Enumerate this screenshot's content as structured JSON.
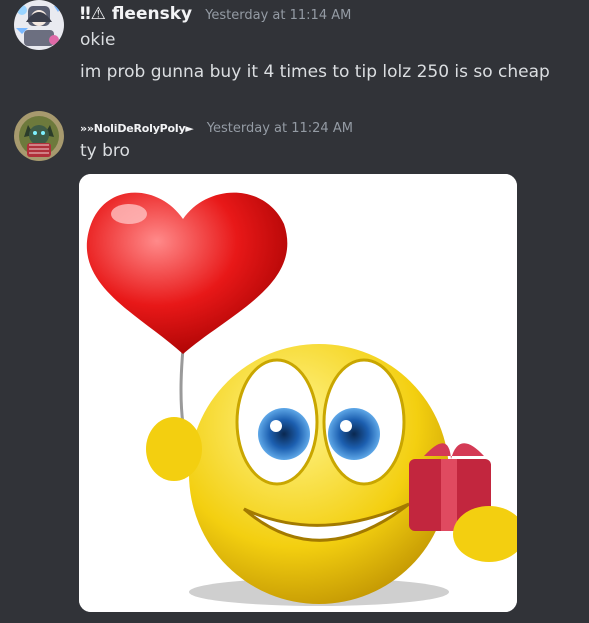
{
  "messages": [
    {
      "username": "‼⚠ fleensky",
      "timestamp": "Yesterday at 11:14 AM",
      "lines": [
        "okie",
        "im prob gunna buy it 4 times to tip lolz 250 is so cheap"
      ],
      "avatar_icon": "anime-character-avatar"
    },
    {
      "username": "»»NoliDeRolyPoly►",
      "timestamp": "Yesterday at 11:24 AM",
      "lines": [
        "ty bro"
      ],
      "avatar_icon": "wolf-character-avatar",
      "attachment": "smiley-heart-balloon-gift-image"
    }
  ],
  "colors": {
    "background": "#313338",
    "username": "#f2f3f5",
    "timestamp": "#949ba4",
    "text": "#dbdee1"
  }
}
